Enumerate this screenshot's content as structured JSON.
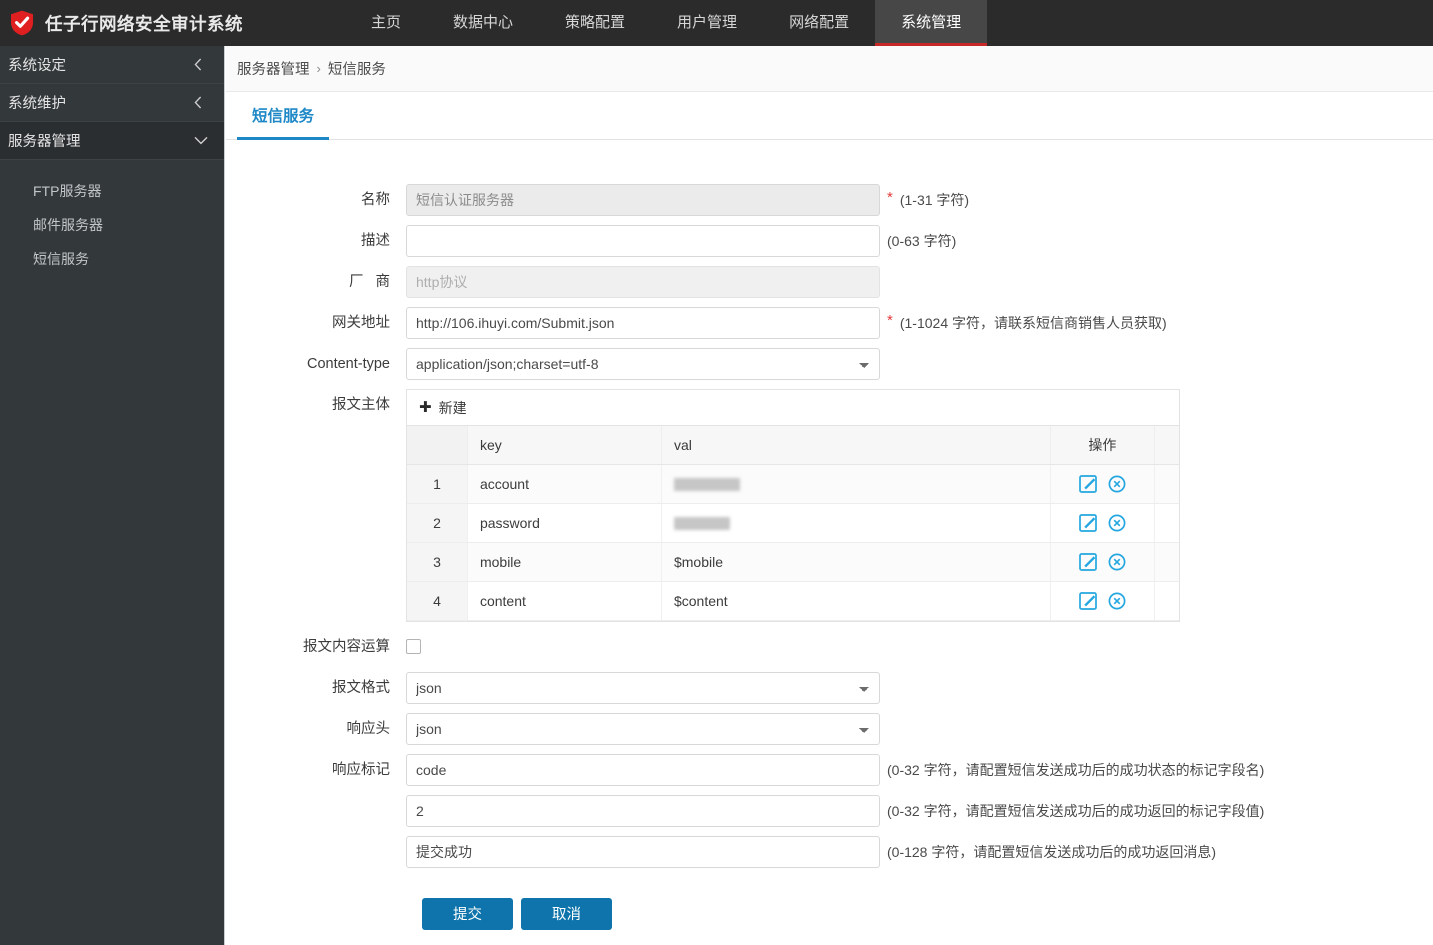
{
  "header": {
    "logo_icon": "shield-check-icon",
    "brand_title": "任子行网络安全审计系统",
    "nav": [
      {
        "label": "主页",
        "active": false
      },
      {
        "label": "数据中心",
        "active": false
      },
      {
        "label": "策略配置",
        "active": false
      },
      {
        "label": "用户管理",
        "active": false
      },
      {
        "label": "网络配置",
        "active": false
      },
      {
        "label": "系统管理",
        "active": true
      }
    ],
    "accent_red": "#c62828",
    "bg": "#2b2b2b"
  },
  "sidebar": {
    "groups": [
      {
        "label": "系统设定",
        "chevron": "chevron-left-icon",
        "expanded": false
      },
      {
        "label": "系统维护",
        "chevron": "chevron-left-icon",
        "expanded": false
      },
      {
        "label": "服务器管理",
        "chevron": "chevron-down-icon",
        "expanded": true
      }
    ],
    "sub_items": [
      {
        "label": "FTP服务器",
        "active": false
      },
      {
        "label": "邮件服务器",
        "active": false
      },
      {
        "label": "短信服务",
        "active": true
      }
    ],
    "bg": "#33383b"
  },
  "breadcrumb": {
    "parent": "服务器管理",
    "separator": "›",
    "current": "短信服务"
  },
  "tabs": [
    {
      "label": "短信服务",
      "active": true
    }
  ],
  "form": {
    "name": {
      "label": "名称",
      "value": "短信认证服务器",
      "required": true,
      "disabled": true,
      "hint": "(1-31 字符)"
    },
    "description": {
      "label": "描述",
      "value": "",
      "placeholder": "",
      "required": false,
      "disabled": false,
      "hint": "(0-63 字符)"
    },
    "vendor": {
      "label": "厂商",
      "value": "http协议",
      "disabled": true,
      "options": [
        "http协议"
      ]
    },
    "gateway": {
      "label": "网关地址",
      "value": "http://106.ihuyi.com/Submit.json",
      "required": true,
      "hint": "(1-1024 字符，请联系短信商销售人员获取)"
    },
    "content_type": {
      "label": "Content-type",
      "value": "application/json;charset=utf-8",
      "options": [
        "application/json;charset=utf-8"
      ]
    },
    "body": {
      "label": "报文主体",
      "new_button": "新建",
      "new_icon": "plus-icon",
      "columns": [
        "",
        "key",
        "val",
        "操作",
        ""
      ],
      "rows": [
        {
          "index": "1",
          "key": "account",
          "val": "",
          "val_redacted": true,
          "redact_width": 66,
          "edit_icon": "edit-icon",
          "delete_icon": "delete-circle-icon"
        },
        {
          "index": "2",
          "key": "password",
          "val": "",
          "val_redacted": true,
          "redact_width": 56,
          "edit_icon": "edit-icon",
          "delete_icon": "delete-circle-icon"
        },
        {
          "index": "3",
          "key": "mobile",
          "val": "$mobile",
          "val_redacted": false,
          "edit_icon": "edit-icon",
          "delete_icon": "delete-circle-icon"
        },
        {
          "index": "4",
          "key": "content",
          "val": "$content",
          "val_redacted": false,
          "edit_icon": "edit-icon",
          "delete_icon": "delete-circle-icon"
        }
      ]
    },
    "body_calc": {
      "label": "报文内容运算",
      "checked": false
    },
    "body_format": {
      "label": "报文格式",
      "value": "json",
      "options": [
        "json"
      ]
    },
    "response_header": {
      "label": "响应头",
      "value": "json",
      "options": [
        "json"
      ]
    },
    "response_mark": {
      "label": "响应标记",
      "fields": [
        {
          "value": "code",
          "hint": "(0-32 字符，请配置短信发送成功后的成功状态的标记字段名)"
        },
        {
          "value": "2",
          "hint": "(0-32 字符，请配置短信发送成功后的成功返回的标记字段值)"
        },
        {
          "value": "提交成功",
          "hint": "(0-128 字符，请配置短信发送成功后的成功返回消息)"
        }
      ]
    },
    "submit_label": "提交",
    "cancel_label": "取消",
    "button_color": "#0e74ab"
  }
}
